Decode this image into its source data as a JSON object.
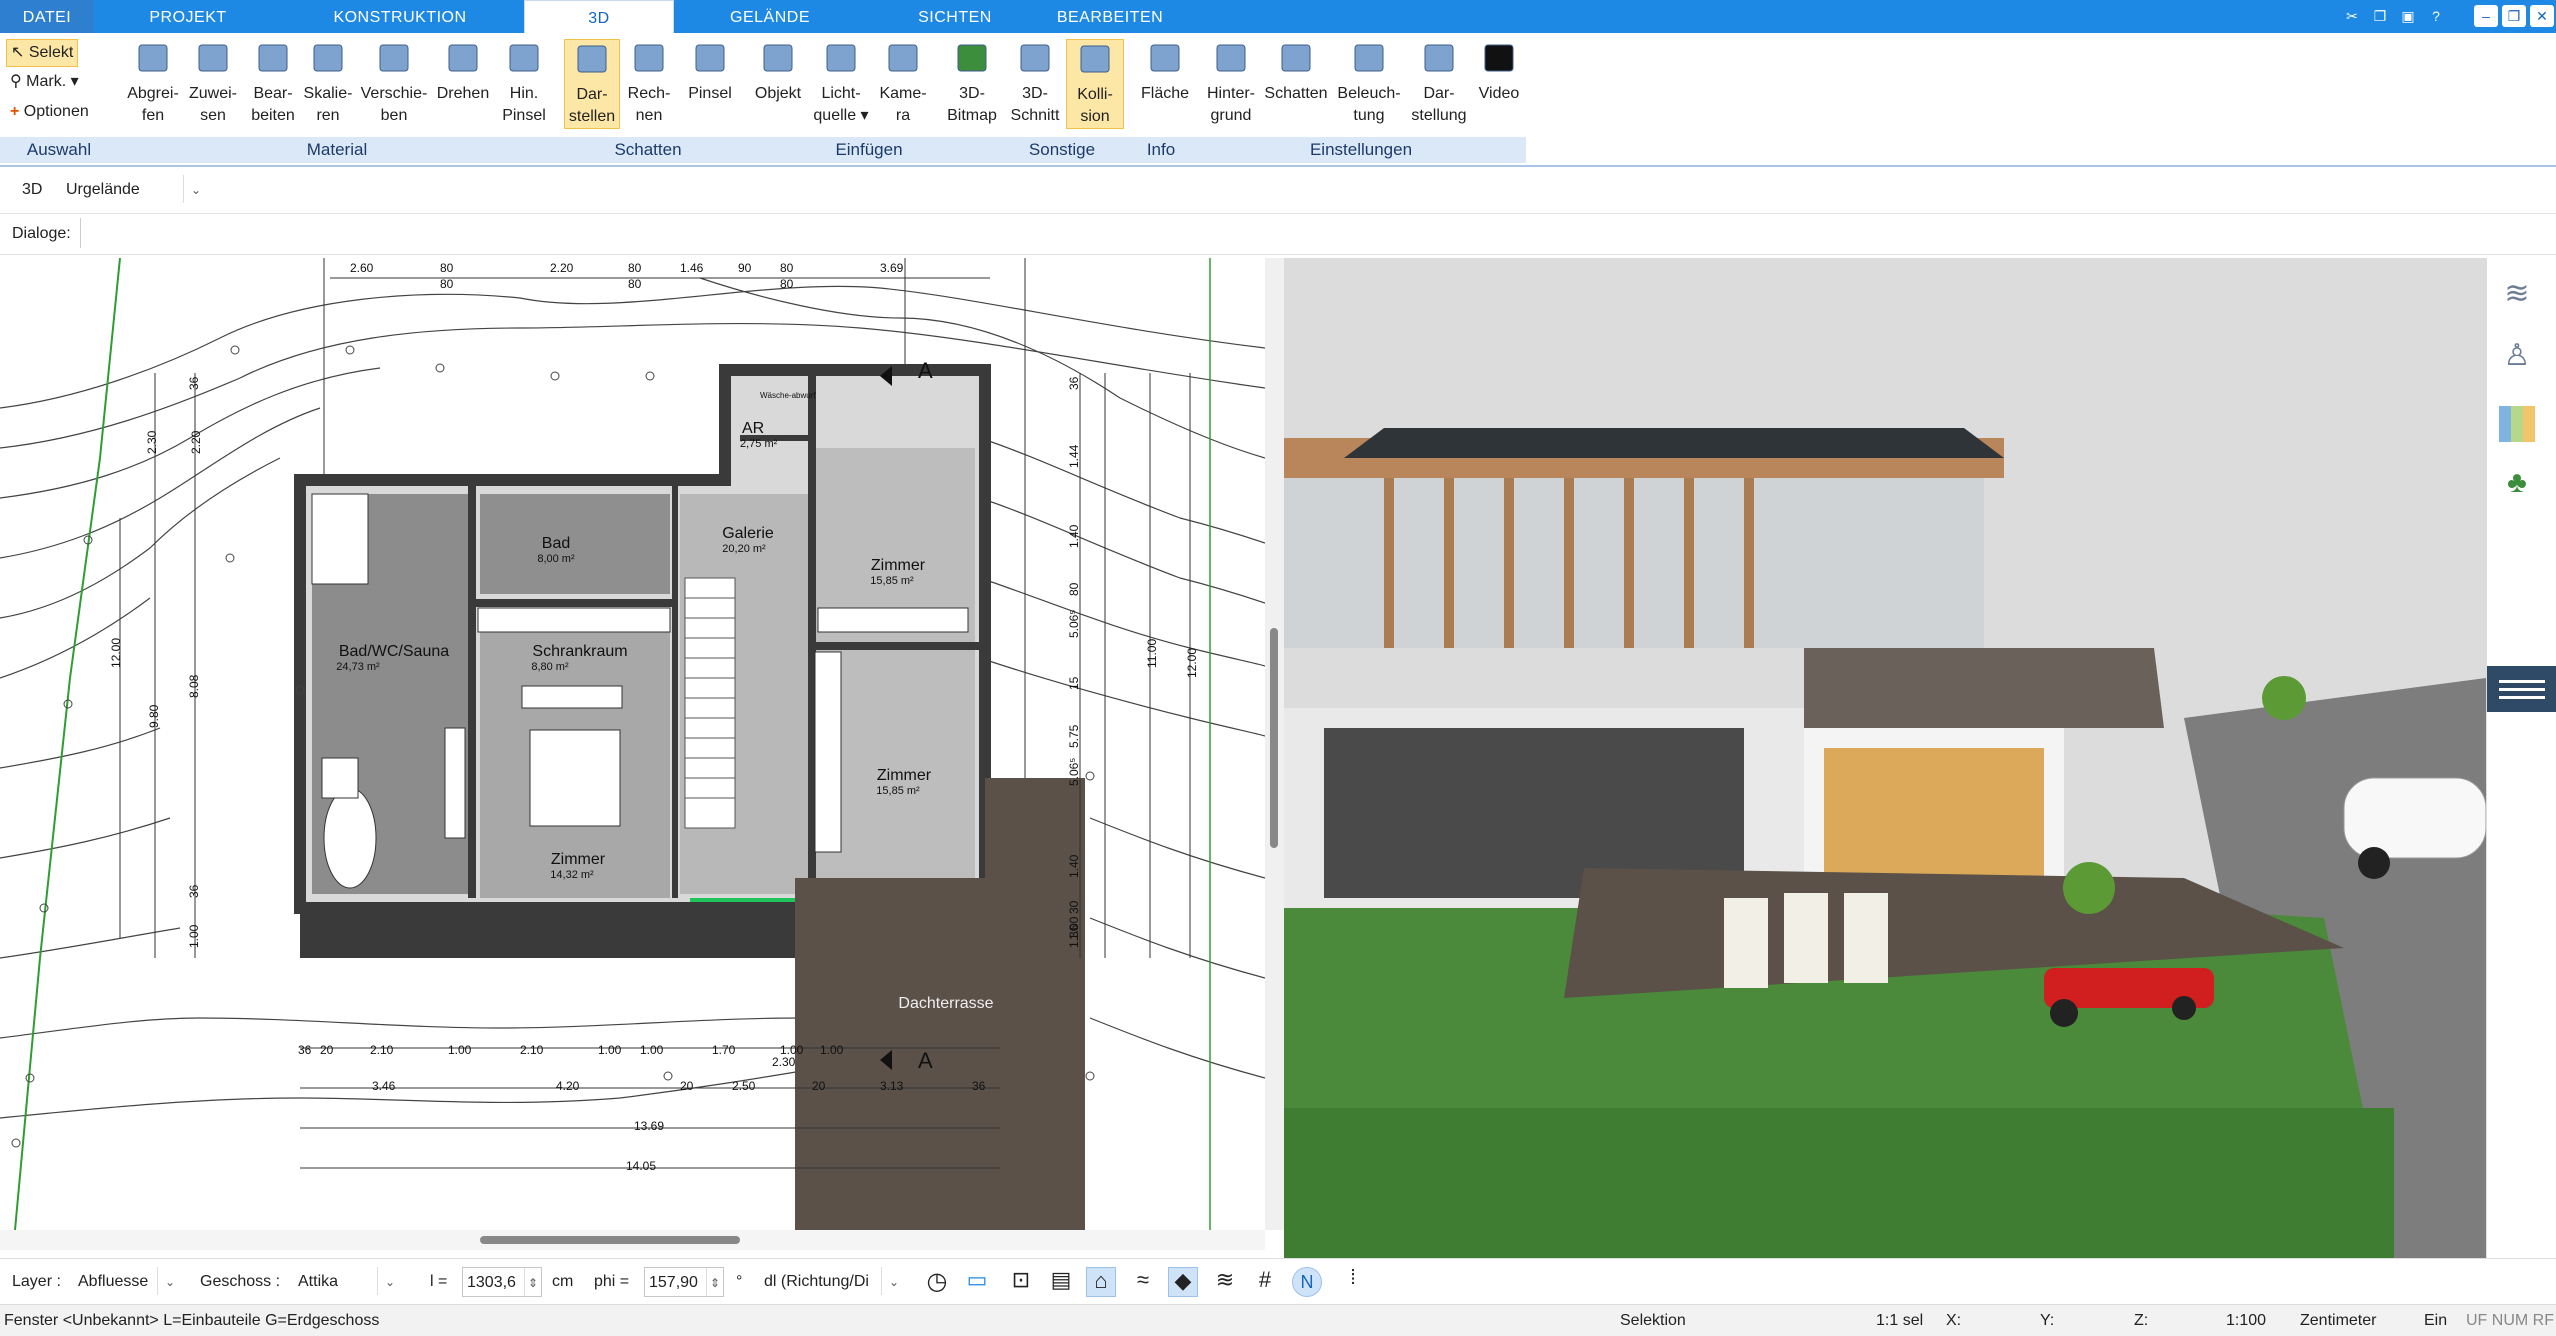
{
  "tabs": [
    {
      "label": "DATEI"
    },
    {
      "label": "PROJEKT"
    },
    {
      "label": "KONSTRUKTION"
    },
    {
      "label": "3D"
    },
    {
      "label": "GELÄNDE"
    },
    {
      "label": "SICHTEN"
    },
    {
      "label": "BEARBEITEN"
    }
  ],
  "selection": {
    "select": "Selekt",
    "mark": "Mark.",
    "options": "Optionen"
  },
  "ribbon": {
    "buttons": [
      {
        "line1": "Abgrei-",
        "line2": "fen",
        "icon": "eyedropper-icon"
      },
      {
        "line1": "Zuwei-",
        "line2": "sen",
        "icon": "assign-material-icon"
      },
      {
        "line1": "Bear-",
        "line2": "beiten",
        "icon": "edit-material-icon"
      },
      {
        "line1": "Skalie-",
        "line2": "ren",
        "icon": "scale-icon"
      },
      {
        "line1": "Verschie-",
        "line2": "ben",
        "icon": "move-icon"
      },
      {
        "line1": "Drehen",
        "line2": "",
        "icon": "rotate-icon"
      },
      {
        "line1": "Hin.",
        "line2": "Pinsel",
        "icon": "brush-icon"
      },
      {
        "line1": "Dar-",
        "line2": "stellen",
        "icon": "shadow-display-icon"
      },
      {
        "line1": "Rech-",
        "line2": "nen",
        "icon": "calculate-icon"
      },
      {
        "line1": "Pinsel",
        "line2": "",
        "icon": "shadow-brush-icon"
      },
      {
        "line1": "Objekt",
        "line2": "",
        "icon": "chair-icon"
      },
      {
        "line1": "Licht-",
        "line2": "quelle ▾",
        "icon": "lightbulb-icon"
      },
      {
        "line1": "Kame-",
        "line2": "ra",
        "icon": "camera-icon"
      },
      {
        "line1": "3D-",
        "line2": "Bitmap",
        "icon": "tree-icon"
      },
      {
        "line1": "3D-",
        "line2": "Schnitt",
        "icon": "section-icon"
      },
      {
        "line1": "Kolli-",
        "line2": "sion",
        "icon": "collision-icon"
      },
      {
        "line1": "Fläche",
        "line2": "",
        "icon": "area-icon"
      },
      {
        "line1": "Hinter-",
        "line2": "grund",
        "icon": "background-icon"
      },
      {
        "line1": "Schatten",
        "line2": "",
        "icon": "house-shadow-icon"
      },
      {
        "line1": "Beleuch-",
        "line2": "tung",
        "icon": "house-light-icon"
      },
      {
        "line1": "Dar-",
        "line2": "stellung",
        "icon": "monitor-icon"
      },
      {
        "line1": "Video",
        "line2": "",
        "icon": "play-icon"
      }
    ],
    "groups": [
      {
        "label": "Auswahl"
      },
      {
        "label": "Material"
      },
      {
        "label": "Schatten"
      },
      {
        "label": "Einfügen"
      },
      {
        "label": "Sonstige"
      },
      {
        "label": "Info"
      },
      {
        "label": "Einstellungen"
      }
    ]
  },
  "toolbar": {
    "view_label": "3D",
    "terrain_select": "Urgelände",
    "dialogs_label": "Dialoge:"
  },
  "plan": {
    "rooms": [
      {
        "name": "Bad",
        "area": "8,00 m²"
      },
      {
        "name": "Galerie",
        "area": "20,20 m²"
      },
      {
        "name": "Zimmer",
        "area": "15,85 m²"
      },
      {
        "name": "AR",
        "area": "2,75 m²"
      },
      {
        "name": "Bad/WC/Sauna",
        "area": "24,73 m²"
      },
      {
        "name": "Schrankraum",
        "area": "8,80 m²"
      },
      {
        "name": "Zimmer",
        "area": "15,85 m²"
      },
      {
        "name": "Zimmer",
        "area": "14,32 m²"
      },
      {
        "name": "Dachterrasse",
        "area": ""
      }
    ],
    "top_dims": [
      "2.60",
      "80",
      "80",
      "2.20",
      "80",
      "80",
      "1.46",
      "90",
      "80",
      "80",
      "3.69"
    ],
    "bottom_dims1": [
      "36",
      "20",
      "2.10",
      "1.00",
      "2.10",
      "1.00",
      "1.00",
      "1.70",
      "1.00",
      "1.00"
    ],
    "bottom_dims2": [
      "3.46",
      "4.20",
      "20",
      "2.50",
      "20",
      "3.13",
      "36"
    ],
    "bottom_dims3": [
      "2.30"
    ],
    "total1": "13.69",
    "total2": "14.05",
    "right_dims": [
      "36",
      "1.44",
      "1.40",
      "80",
      "5.06⁵",
      "15",
      "5.75",
      "5.06⁵",
      "1.40",
      "30",
      "1.00",
      "1.36"
    ],
    "right_totals": [
      "11.00",
      "12.00"
    ],
    "left_dims": [
      "36",
      "2.20",
      "2.30",
      "8.08",
      "9.80",
      "12.00",
      "36",
      "1.00"
    ],
    "section_label": "A",
    "wash_label": "Wäsche-abwurf"
  },
  "bottom": {
    "layer_label": "Layer :",
    "layer_value": "Abfluesse",
    "floor_label": "Geschoss :",
    "floor_value": "Attika",
    "l_label": "l =",
    "l_value": "1303,6",
    "l_unit": "cm",
    "phi_label": "phi =",
    "phi_value": "157,90",
    "phi_unit": "°",
    "dl_value": "dl (Richtung/Di"
  },
  "status": {
    "left": "Fenster <Unbekannt> L=Einbauteile G=Erdgeschoss",
    "mode": "Selektion",
    "sel": "1:1 sel",
    "x": "X:",
    "y": "Y:",
    "z": "Z:",
    "scale": "1:100",
    "unit": "Zentimeter",
    "ein": "Ein",
    "flags": "UF NUM RF"
  },
  "colors": {
    "accent": "#1e88e5",
    "ribbon_group": "#dbe8f7",
    "active_btn": "#fde7a6",
    "grass": "#4a8a3a",
    "deck": "#5b5148"
  }
}
